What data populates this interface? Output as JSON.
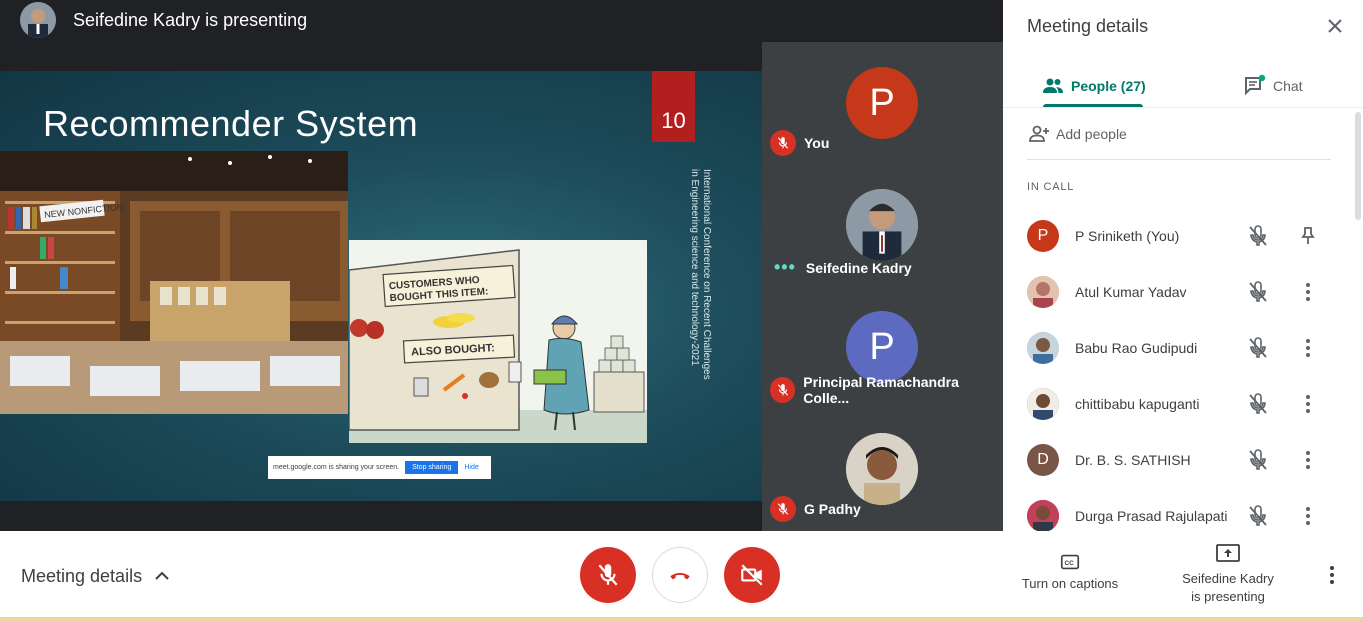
{
  "presenter_bar": {
    "text": "Seifedine Kadry is presenting"
  },
  "slide": {
    "title": "Recommender System",
    "number": "10",
    "vertical_text": "International Conference on Recent Challenges in Engineering science and technology-2021",
    "cartoon_sign_1": "CUSTOMERS WHO BOUGHT THIS ITEM:",
    "cartoon_sign_2": "ALSO BOUGHT:",
    "shelf_sign": "NEW NONFICTION"
  },
  "share_banner": {
    "text": "meet.google.com is sharing your screen.",
    "stop_label": "Stop sharing",
    "hide_label": "Hide"
  },
  "tiles": [
    {
      "name": "You",
      "initial": "P",
      "color": "#c5391a",
      "muted": true
    },
    {
      "name": "Seifedine Kadry",
      "initial": "",
      "muted": false
    },
    {
      "name": "Principal Ramachandra Colle...",
      "initial": "P",
      "color": "#5c6bc0",
      "muted": true
    },
    {
      "name": "G Padhy",
      "initial": "",
      "muted": true
    }
  ],
  "panel": {
    "title": "Meeting details",
    "tab_people": "People (27)",
    "tab_chat": "Chat",
    "add_people": "Add people",
    "section_label": "IN CALL",
    "people": [
      {
        "name": "P Sriniketh (You)",
        "initial": "P",
        "color": "#c5391a"
      },
      {
        "name": "Atul Kumar Yadav",
        "initial": "",
        "color": "#d7a08a"
      },
      {
        "name": "Babu Rao Gudipudi",
        "initial": "",
        "color": "#9fb7c9"
      },
      {
        "name": "chittibabu kapuganti",
        "initial": "",
        "color": "#6d5a4a"
      },
      {
        "name": "Dr. B. S. SATHISH",
        "initial": "D",
        "color": "#795548"
      },
      {
        "name": "Durga Prasad Rajulapati",
        "initial": "",
        "color": "#a3364a"
      }
    ]
  },
  "bottom": {
    "meeting_details": "Meeting details",
    "captions_label": "Turn on captions",
    "presenting_line1": "Seifedine Kadry",
    "presenting_line2": "is presenting"
  },
  "colors": {
    "accent": "#00796b",
    "danger": "#d93025"
  }
}
